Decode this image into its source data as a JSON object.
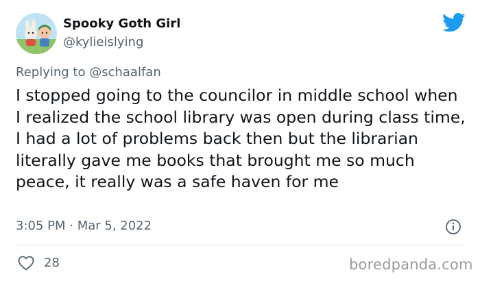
{
  "author": {
    "display_name": "Spooky Goth Girl",
    "handle": "@kylieislying",
    "avatar_icon": "avatar-image"
  },
  "platform_icon": "twitter-bird-icon",
  "reply": {
    "prefix": "Replying to",
    "mention": "@schaalfan"
  },
  "tweet_text": "I stopped going to the councilor in middle school when I realized the school library was open during class time, I had a lot of problems back then but the librarian literally gave me books that brought me so much peace, it really was a safe haven for me",
  "timestamp": "3:05 PM · Mar 5, 2022",
  "likes": {
    "count": "28",
    "icon": "heart-icon"
  },
  "watermark": "boredpanda.com",
  "colors": {
    "twitter_blue": "#1d9bf0",
    "secondary_text": "#536471",
    "primary_text": "#0f1419"
  }
}
